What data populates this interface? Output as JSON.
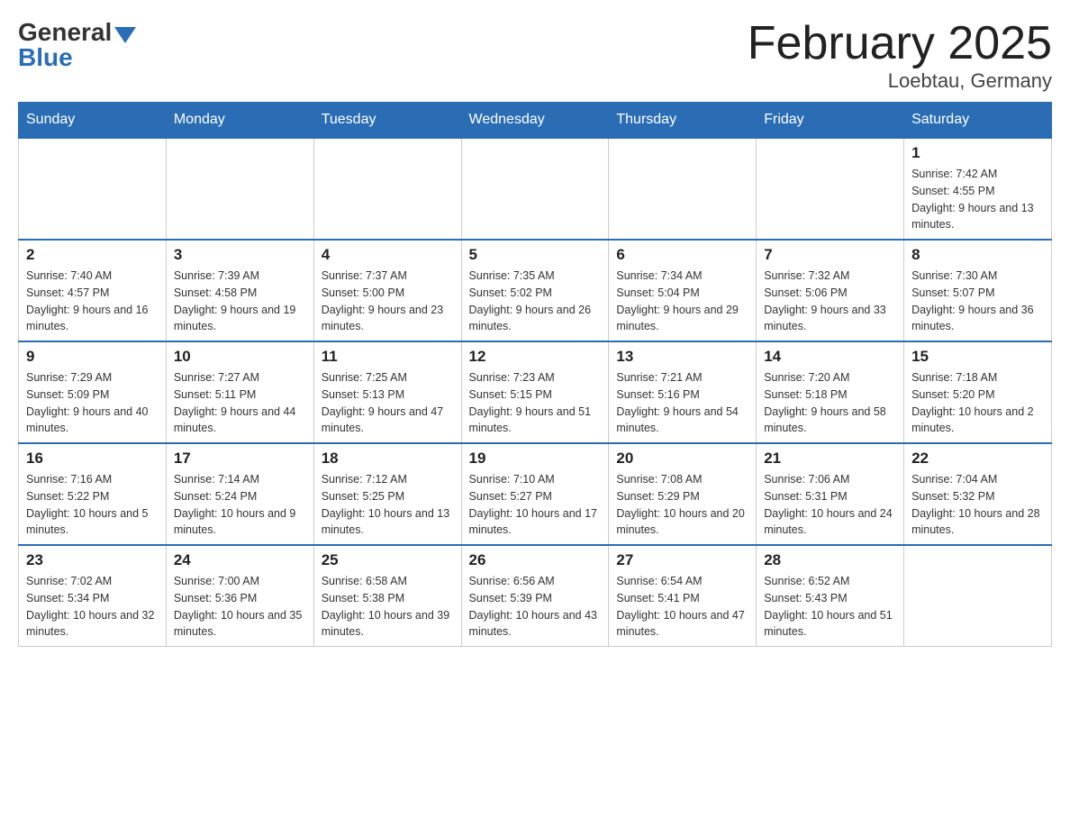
{
  "logo": {
    "general": "General",
    "blue": "Blue"
  },
  "title": "February 2025",
  "subtitle": "Loebtau, Germany",
  "days_of_week": [
    "Sunday",
    "Monday",
    "Tuesday",
    "Wednesday",
    "Thursday",
    "Friday",
    "Saturday"
  ],
  "weeks": [
    [
      {
        "day": "",
        "info": ""
      },
      {
        "day": "",
        "info": ""
      },
      {
        "day": "",
        "info": ""
      },
      {
        "day": "",
        "info": ""
      },
      {
        "day": "",
        "info": ""
      },
      {
        "day": "",
        "info": ""
      },
      {
        "day": "1",
        "info": "Sunrise: 7:42 AM\nSunset: 4:55 PM\nDaylight: 9 hours and 13 minutes."
      }
    ],
    [
      {
        "day": "2",
        "info": "Sunrise: 7:40 AM\nSunset: 4:57 PM\nDaylight: 9 hours and 16 minutes."
      },
      {
        "day": "3",
        "info": "Sunrise: 7:39 AM\nSunset: 4:58 PM\nDaylight: 9 hours and 19 minutes."
      },
      {
        "day": "4",
        "info": "Sunrise: 7:37 AM\nSunset: 5:00 PM\nDaylight: 9 hours and 23 minutes."
      },
      {
        "day": "5",
        "info": "Sunrise: 7:35 AM\nSunset: 5:02 PM\nDaylight: 9 hours and 26 minutes."
      },
      {
        "day": "6",
        "info": "Sunrise: 7:34 AM\nSunset: 5:04 PM\nDaylight: 9 hours and 29 minutes."
      },
      {
        "day": "7",
        "info": "Sunrise: 7:32 AM\nSunset: 5:06 PM\nDaylight: 9 hours and 33 minutes."
      },
      {
        "day": "8",
        "info": "Sunrise: 7:30 AM\nSunset: 5:07 PM\nDaylight: 9 hours and 36 minutes."
      }
    ],
    [
      {
        "day": "9",
        "info": "Sunrise: 7:29 AM\nSunset: 5:09 PM\nDaylight: 9 hours and 40 minutes."
      },
      {
        "day": "10",
        "info": "Sunrise: 7:27 AM\nSunset: 5:11 PM\nDaylight: 9 hours and 44 minutes."
      },
      {
        "day": "11",
        "info": "Sunrise: 7:25 AM\nSunset: 5:13 PM\nDaylight: 9 hours and 47 minutes."
      },
      {
        "day": "12",
        "info": "Sunrise: 7:23 AM\nSunset: 5:15 PM\nDaylight: 9 hours and 51 minutes."
      },
      {
        "day": "13",
        "info": "Sunrise: 7:21 AM\nSunset: 5:16 PM\nDaylight: 9 hours and 54 minutes."
      },
      {
        "day": "14",
        "info": "Sunrise: 7:20 AM\nSunset: 5:18 PM\nDaylight: 9 hours and 58 minutes."
      },
      {
        "day": "15",
        "info": "Sunrise: 7:18 AM\nSunset: 5:20 PM\nDaylight: 10 hours and 2 minutes."
      }
    ],
    [
      {
        "day": "16",
        "info": "Sunrise: 7:16 AM\nSunset: 5:22 PM\nDaylight: 10 hours and 5 minutes."
      },
      {
        "day": "17",
        "info": "Sunrise: 7:14 AM\nSunset: 5:24 PM\nDaylight: 10 hours and 9 minutes."
      },
      {
        "day": "18",
        "info": "Sunrise: 7:12 AM\nSunset: 5:25 PM\nDaylight: 10 hours and 13 minutes."
      },
      {
        "day": "19",
        "info": "Sunrise: 7:10 AM\nSunset: 5:27 PM\nDaylight: 10 hours and 17 minutes."
      },
      {
        "day": "20",
        "info": "Sunrise: 7:08 AM\nSunset: 5:29 PM\nDaylight: 10 hours and 20 minutes."
      },
      {
        "day": "21",
        "info": "Sunrise: 7:06 AM\nSunset: 5:31 PM\nDaylight: 10 hours and 24 minutes."
      },
      {
        "day": "22",
        "info": "Sunrise: 7:04 AM\nSunset: 5:32 PM\nDaylight: 10 hours and 28 minutes."
      }
    ],
    [
      {
        "day": "23",
        "info": "Sunrise: 7:02 AM\nSunset: 5:34 PM\nDaylight: 10 hours and 32 minutes."
      },
      {
        "day": "24",
        "info": "Sunrise: 7:00 AM\nSunset: 5:36 PM\nDaylight: 10 hours and 35 minutes."
      },
      {
        "day": "25",
        "info": "Sunrise: 6:58 AM\nSunset: 5:38 PM\nDaylight: 10 hours and 39 minutes."
      },
      {
        "day": "26",
        "info": "Sunrise: 6:56 AM\nSunset: 5:39 PM\nDaylight: 10 hours and 43 minutes."
      },
      {
        "day": "27",
        "info": "Sunrise: 6:54 AM\nSunset: 5:41 PM\nDaylight: 10 hours and 47 minutes."
      },
      {
        "day": "28",
        "info": "Sunrise: 6:52 AM\nSunset: 5:43 PM\nDaylight: 10 hours and 51 minutes."
      },
      {
        "day": "",
        "info": ""
      }
    ]
  ]
}
